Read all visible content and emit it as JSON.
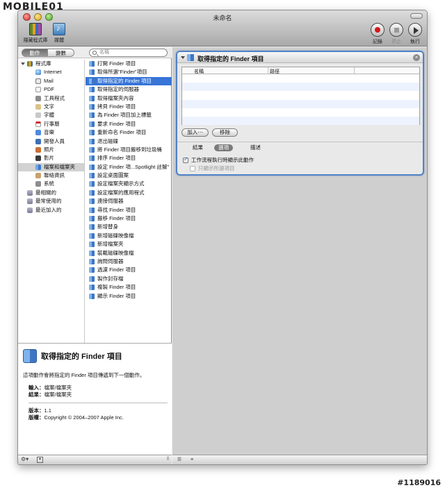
{
  "watermark": "MOBILE01",
  "post_id": "#1189016",
  "window": {
    "title": "未命名"
  },
  "toolbar": {
    "library_label": "隱藏程式庫",
    "media_label": "媒體",
    "record_label": "記錄",
    "stop_label": "停止",
    "run_label": "執行"
  },
  "left_top": {
    "actions_tab": "動作",
    "variables_tab": "變數",
    "search_placeholder": "名稱"
  },
  "categories": [
    {
      "label": "程式庫",
      "level": 0,
      "icon": "library-icon"
    },
    {
      "label": "Internet",
      "level": 1,
      "icon": "globe-icon"
    },
    {
      "label": "Mail",
      "level": 1,
      "icon": "mail-icon"
    },
    {
      "label": "PDF",
      "level": 1,
      "icon": "pdf-icon"
    },
    {
      "label": "工具程式",
      "level": 1,
      "icon": "tools-icon"
    },
    {
      "label": "文字",
      "level": 1,
      "icon": "text-icon"
    },
    {
      "label": "字體",
      "level": 1,
      "icon": "font-icon"
    },
    {
      "label": "行事曆",
      "level": 1,
      "icon": "calendar-icon"
    },
    {
      "label": "音樂",
      "level": 1,
      "icon": "music-icon"
    },
    {
      "label": "開發人員",
      "level": 1,
      "icon": "developer-icon"
    },
    {
      "label": "照片",
      "level": 1,
      "icon": "photo-icon"
    },
    {
      "label": "影片",
      "level": 1,
      "icon": "movie-icon"
    },
    {
      "label": "檔案和檔案夾",
      "level": 1,
      "icon": "finder-icon",
      "selected": true
    },
    {
      "label": "聯絡資訊",
      "level": 1,
      "icon": "contacts-icon"
    },
    {
      "label": "系統",
      "level": 1,
      "icon": "system-icon"
    },
    {
      "label": "最相關的",
      "level": 0,
      "icon": "smart-folder-icon"
    },
    {
      "label": "最常使用的",
      "level": 0,
      "icon": "smart-folder-icon"
    },
    {
      "label": "最近加入的",
      "level": 0,
      "icon": "smart-folder-icon"
    }
  ],
  "actions": [
    "打開 Finder 項目",
    "取得所選\"Finder\"項目",
    "取得指定的 Finder 項目",
    "取得指定的伺服器",
    "取得檔案夾內容",
    "拷貝 Finder 項目",
    "為 Finder 項目加上標籤",
    "要求 Finder 項目",
    "重新命名 Finder 項目",
    "退出磁碟",
    "將 Finder 項目搬移到垃圾桶",
    "排序 Finder 項目",
    "設定 Finder 項...Spotlight 註解\"",
    "設定桌面圖案",
    "設定檔案夾顯示方式",
    "設定檔案的應用程式",
    "連接伺服器",
    "尋找 Finder 項目",
    "搬移 Finder 項目",
    "新增替身",
    "新增磁碟映像檔",
    "新增檔案夾",
    "裝載磁碟映像檔",
    "詢問伺服器",
    "過濾 Finder 項目",
    "製作封存檔",
    "複製 Finder 項目",
    "顯示 Finder 項目"
  ],
  "selected_action_index": 2,
  "description": {
    "title": "取得指定的 Finder 項目",
    "text": "這項動作會將指定的 Finder 項目傳遞到下一個動作。",
    "input_label": "輸入：",
    "input_value": "檔案/檔案夾",
    "result_label": "結果：",
    "result_value": "檔案/檔案夾",
    "version_label": "版本：",
    "version_value": "1.1",
    "copyright_label": "版權：",
    "copyright_value": "Copyright © 2004–2007 Apple Inc."
  },
  "card": {
    "title": "取得指定的 Finder 項目",
    "col_name": "名稱",
    "col_path": "路徑",
    "add_button": "加入⋯",
    "remove_button": "移除",
    "tab_results": "結果",
    "tab_options": "選項",
    "tab_description": "描述",
    "opt_show_action": "工作流程執行時顯示此動作",
    "opt_show_selected": "只顯示所選項目"
  }
}
